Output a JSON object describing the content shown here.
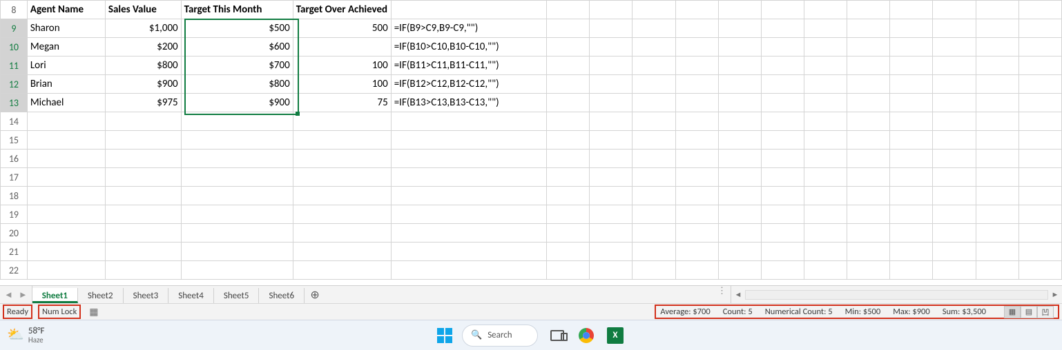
{
  "row_numbers": [
    "8",
    "9",
    "10",
    "11",
    "12",
    "13",
    "14",
    "15",
    "16",
    "17",
    "18",
    "19",
    "20",
    "21",
    "22"
  ],
  "headers": {
    "A": "Agent Name",
    "B": "Sales Value",
    "C": "Target This Month",
    "D": "Target Over Achieved",
    "E": ""
  },
  "rows": [
    {
      "A": "Sharon",
      "B": "$1,000",
      "C": "$500",
      "D": "500",
      "E": "=IF(B9>C9,B9-C9,\"\")"
    },
    {
      "A": "Megan",
      "B": "$200",
      "C": "$600",
      "D": "",
      "E": "=IF(B10>C10,B10-C10,\"\")"
    },
    {
      "A": "Lori",
      "B": "$800",
      "C": "$700",
      "D": "100",
      "E": "=IF(B11>C11,B11-C11,\"\")"
    },
    {
      "A": "Brian",
      "B": "$900",
      "C": "$800",
      "D": "100",
      "E": "=IF(B12>C12,B12-C12,\"\")"
    },
    {
      "A": "Michael",
      "B": "$975",
      "C": "$900",
      "D": "75",
      "E": "=IF(B13>C13,B13-C13,\"\")"
    }
  ],
  "sheet_tabs": [
    "Sheet1",
    "Sheet2",
    "Sheet3",
    "Sheet4",
    "Sheet5",
    "Sheet6"
  ],
  "active_tab_index": 0,
  "status": {
    "ready": "Ready",
    "numlock": "Num Lock",
    "stats": {
      "average": "Average: $700",
      "count": "Count: 5",
      "numcount": "Numerical Count: 5",
      "min": "Min: $500",
      "max": "Max: $900",
      "sum": "Sum: $3,500"
    }
  },
  "taskbar": {
    "temp": "58°F",
    "condition": "Haze",
    "search_placeholder": "Search"
  }
}
